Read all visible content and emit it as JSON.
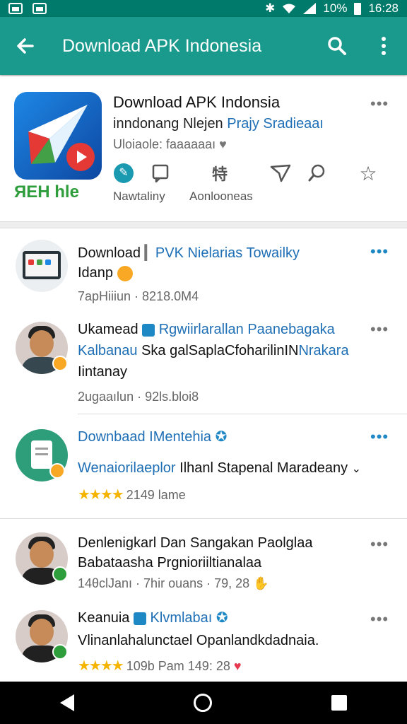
{
  "status_bar": {
    "battery": "10%",
    "time": "16:28"
  },
  "app_bar": {
    "title": "Download APK Indonesia"
  },
  "header": {
    "app_title": "Download APK Indonsia",
    "subtitle_plain": "inndonang Nlejen ",
    "subtitle_accent": "Prajy Sradieaaı",
    "meta": "Uloiaole: faaaaaaı",
    "brand_text": "ЯЕН hle",
    "actions": [
      {
        "icon": "leaf-icon",
        "label": "Nawtaliny"
      },
      {
        "icon": "bookmark-icon",
        "label": ""
      },
      {
        "icon": "translate-icon",
        "label": "Aonlooneas"
      },
      {
        "icon": "send-icon",
        "label": ""
      },
      {
        "icon": "search-icon",
        "label": ""
      },
      {
        "icon": "star-outline-icon",
        "label": ""
      }
    ]
  },
  "feed": [
    {
      "name": "Download",
      "name_accent": "PVK Nielarias Towailky",
      "body": [
        "Idanp"
      ],
      "meta": "7apHiiiun · 8218.0M4"
    },
    {
      "name": "Ukamead",
      "name_accent": "Rgwiirlarallan Paanebagaka",
      "body_accent": "Kalbanau",
      "body": [
        "Ska galSaplaCfoharilinIN",
        "Iintanay"
      ],
      "body_tail": "Nrakara",
      "meta": "2ugaaılun · 92ls.bloi8"
    },
    {
      "name": "Downbaad IMentehia",
      "body_accent": "Wenaiorilaeplor",
      "body": [
        "Ilhanl Stapenal Maradeany"
      ],
      "rating": "★★★★",
      "meta": "2149 lame"
    },
    {
      "name": "Denlenigkarl Dan Sangakan Paolglaa",
      "body": [
        "Babataasha Prgnioriiltianalaa"
      ],
      "meta": "14θclJanı · 7hir ouans · 79, 28"
    },
    {
      "name": "Keanuia",
      "name_accent": "Klvmlabaı",
      "body": [
        "Vlinanlahalunctael Opanlandkdadnaia."
      ],
      "rating": "★★★★",
      "meta": "109b Pam 149: 28"
    }
  ],
  "colors": {
    "status": "#007a6a",
    "app_bar": "#1a9a8c",
    "accent_blue": "#1e6fb5",
    "star": "#f5b400",
    "brand_green": "#2e9d3b"
  }
}
